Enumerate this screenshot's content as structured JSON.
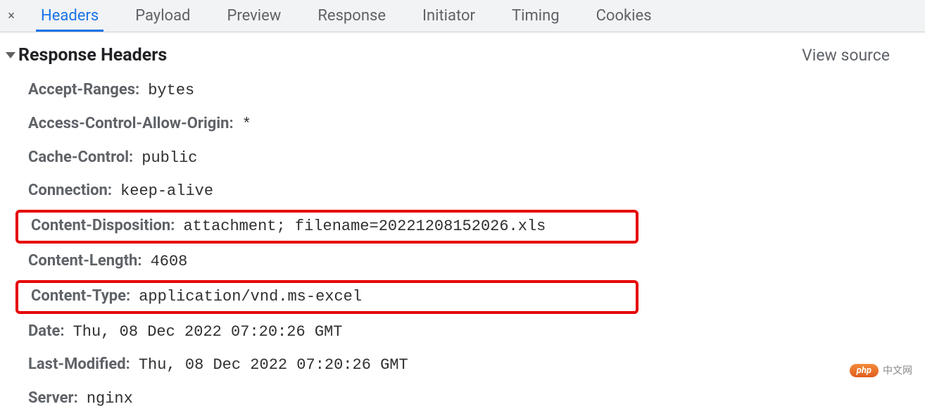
{
  "tabs": {
    "items": [
      {
        "label": "Headers",
        "active": true
      },
      {
        "label": "Payload",
        "active": false
      },
      {
        "label": "Preview",
        "active": false
      },
      {
        "label": "Response",
        "active": false
      },
      {
        "label": "Initiator",
        "active": false
      },
      {
        "label": "Timing",
        "active": false
      },
      {
        "label": "Cookies",
        "active": false
      }
    ]
  },
  "section": {
    "title": "Response Headers",
    "view_source": "View source"
  },
  "headers": [
    {
      "key": "Accept-Ranges:",
      "value": "bytes",
      "highlighted": false
    },
    {
      "key": "Access-Control-Allow-Origin:",
      "value": "*",
      "highlighted": false
    },
    {
      "key": "Cache-Control:",
      "value": "public",
      "highlighted": false
    },
    {
      "key": "Connection:",
      "value": "keep-alive",
      "highlighted": false
    },
    {
      "key": "Content-Disposition:",
      "value": "attachment; filename=20221208152026.xls",
      "highlighted": true
    },
    {
      "key": "Content-Length:",
      "value": "4608",
      "highlighted": false
    },
    {
      "key": "Content-Type:",
      "value": "application/vnd.ms-excel",
      "highlighted": true
    },
    {
      "key": "Date:",
      "value": "Thu, 08 Dec 2022 07:20:26 GMT",
      "highlighted": false
    },
    {
      "key": "Last-Modified:",
      "value": "Thu, 08 Dec 2022 07:20:26 GMT",
      "highlighted": false
    },
    {
      "key": "Server:",
      "value": "nginx",
      "highlighted": false
    }
  ],
  "watermark": {
    "badge": "php",
    "text": "中文网"
  }
}
